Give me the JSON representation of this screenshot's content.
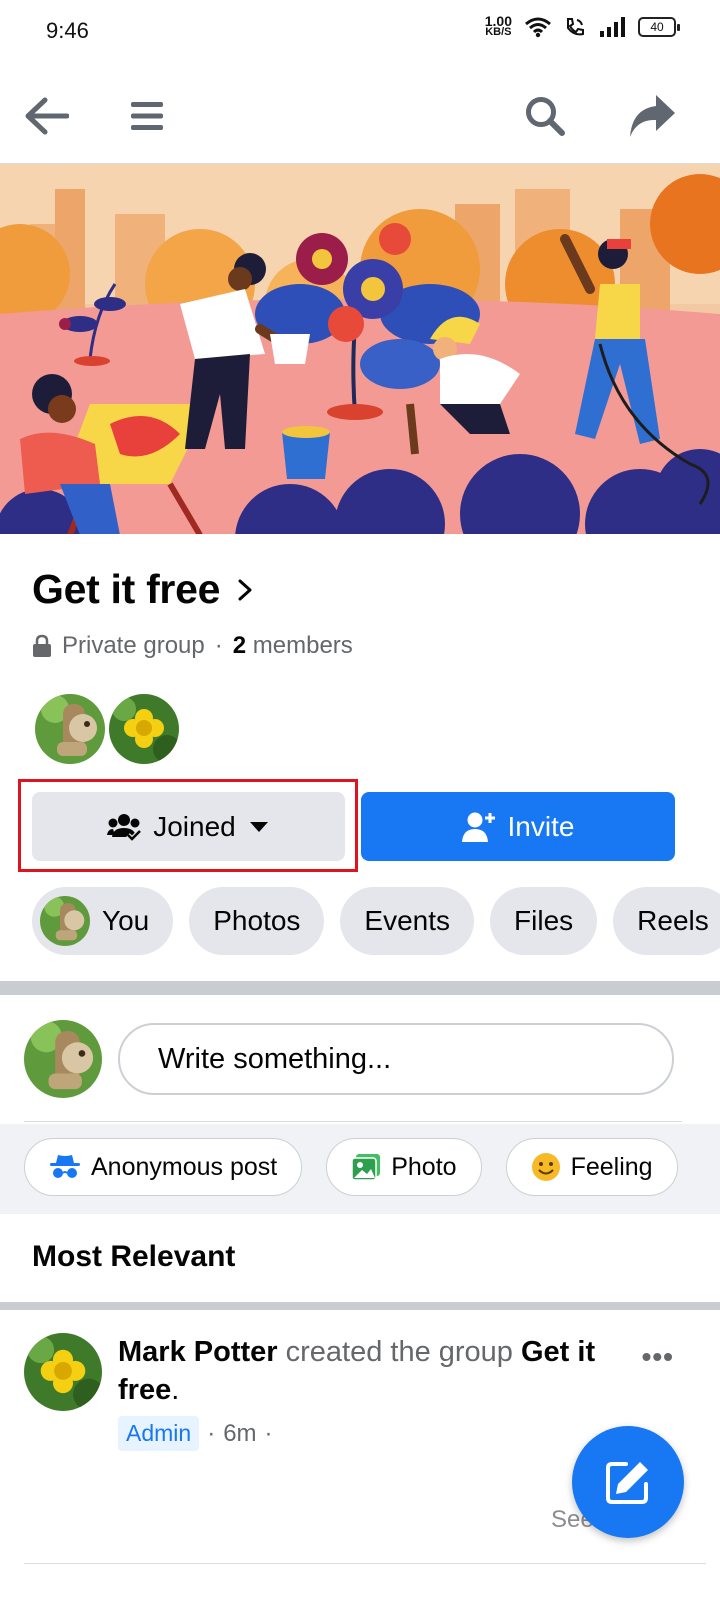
{
  "status_bar": {
    "time": "9:46",
    "net_speed_value": "1.00",
    "net_speed_unit": "KB/S",
    "battery": "40"
  },
  "nav": {
    "back_icon": "arrow-left-icon",
    "menu_icon": "hamburger-menu-icon",
    "search_icon": "search-icon",
    "share_icon": "share-icon"
  },
  "group": {
    "title": "Get it free",
    "privacy": "Private group",
    "separator": "·",
    "member_count": "2",
    "members_label": "members"
  },
  "buttons": {
    "joined_label": "Joined",
    "invite_label": "Invite"
  },
  "tabs": [
    {
      "label": "You"
    },
    {
      "label": "Photos"
    },
    {
      "label": "Events"
    },
    {
      "label": "Files"
    },
    {
      "label": "Reels"
    }
  ],
  "composer": {
    "placeholder": "Write something..."
  },
  "post_actions": [
    {
      "label": "Anonymous post",
      "icon": "incognito-icon"
    },
    {
      "label": "Photo",
      "icon": "photo-icon"
    },
    {
      "label": "Feeling",
      "icon": "smiley-icon"
    }
  ],
  "feed": {
    "sort_label": "Most Relevant"
  },
  "post": {
    "author": "Mark Potter",
    "action_text": " created the group ",
    "group_name": "Get it free",
    "end_punct": ".",
    "badge": "Admin",
    "time": "6m",
    "dot": "·",
    "see_label": "See"
  },
  "colors": {
    "accent": "#1877f2",
    "highlight_border": "#e0141e",
    "chip_bg": "#e4e6eb"
  }
}
